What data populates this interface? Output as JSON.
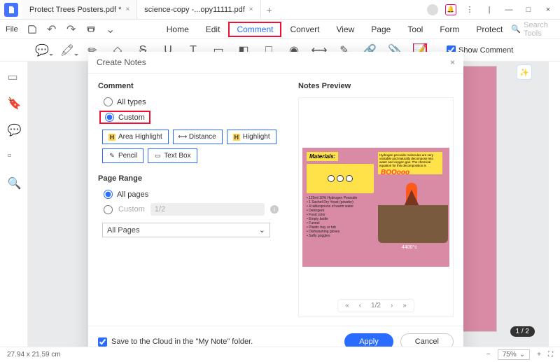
{
  "titlebar": {
    "tabs": [
      {
        "label": "Protect Trees Posters.pdf *",
        "active": false
      },
      {
        "label": "science-copy -...opy11111.pdf",
        "active": true
      }
    ]
  },
  "menubar": {
    "file": "File",
    "items": [
      "Home",
      "Edit",
      "Comment",
      "Convert",
      "View",
      "Page",
      "Tool",
      "Form",
      "Protect"
    ],
    "active_index": 2,
    "search_placeholder": "Search Tools"
  },
  "toolbar": {
    "show_comment_label": "Show Comment",
    "show_comment_checked": true
  },
  "dialog": {
    "title": "Create Notes",
    "close": "×",
    "comment_section": "Comment",
    "all_types_label": "All types",
    "custom_label": "Custom",
    "custom_selected": true,
    "chips": [
      "Area Highlight",
      "Distance",
      "Highlight",
      "Pencil",
      "Text Box"
    ],
    "page_range_section": "Page Range",
    "all_pages_label": "All pages",
    "all_pages_selected": true,
    "custom_range_label": "Custom",
    "custom_range_placeholder": "1/2",
    "select_value": "All Pages",
    "preview_section": "Notes Preview",
    "preview": {
      "materials_label": "Materials:",
      "boom": "BOOooo",
      "temp": "4400°c",
      "note_text": "Hydrogen peroxide molecules are very unstable and naturally decompose into water and oxygen gas. The chemical equation for this decomposition is",
      "list": [
        "125ml 10% Hydrogen Peroxide",
        "1 Sachet Dry Yeast (powder)",
        "4 tablespoons of warm water",
        "Detergent",
        "Food color",
        "Empty bottle",
        "Funnel",
        "Plastic tray or tub",
        "Dishwashing gloves",
        "Safty goggles"
      ]
    },
    "pager": {
      "first": "«",
      "prev": "‹",
      "value": "1/2",
      "next": "›",
      "last": "»"
    },
    "save_cloud": "Save to the Cloud in the \"My Note\" folder.",
    "save_cloud_checked": true,
    "apply": "Apply",
    "cancel": "Cancel"
  },
  "workspace": {
    "page_indicator": "1 / 2"
  },
  "statusbar": {
    "dimensions": "27.94 x 21.59 cm",
    "zoom": "75%"
  }
}
